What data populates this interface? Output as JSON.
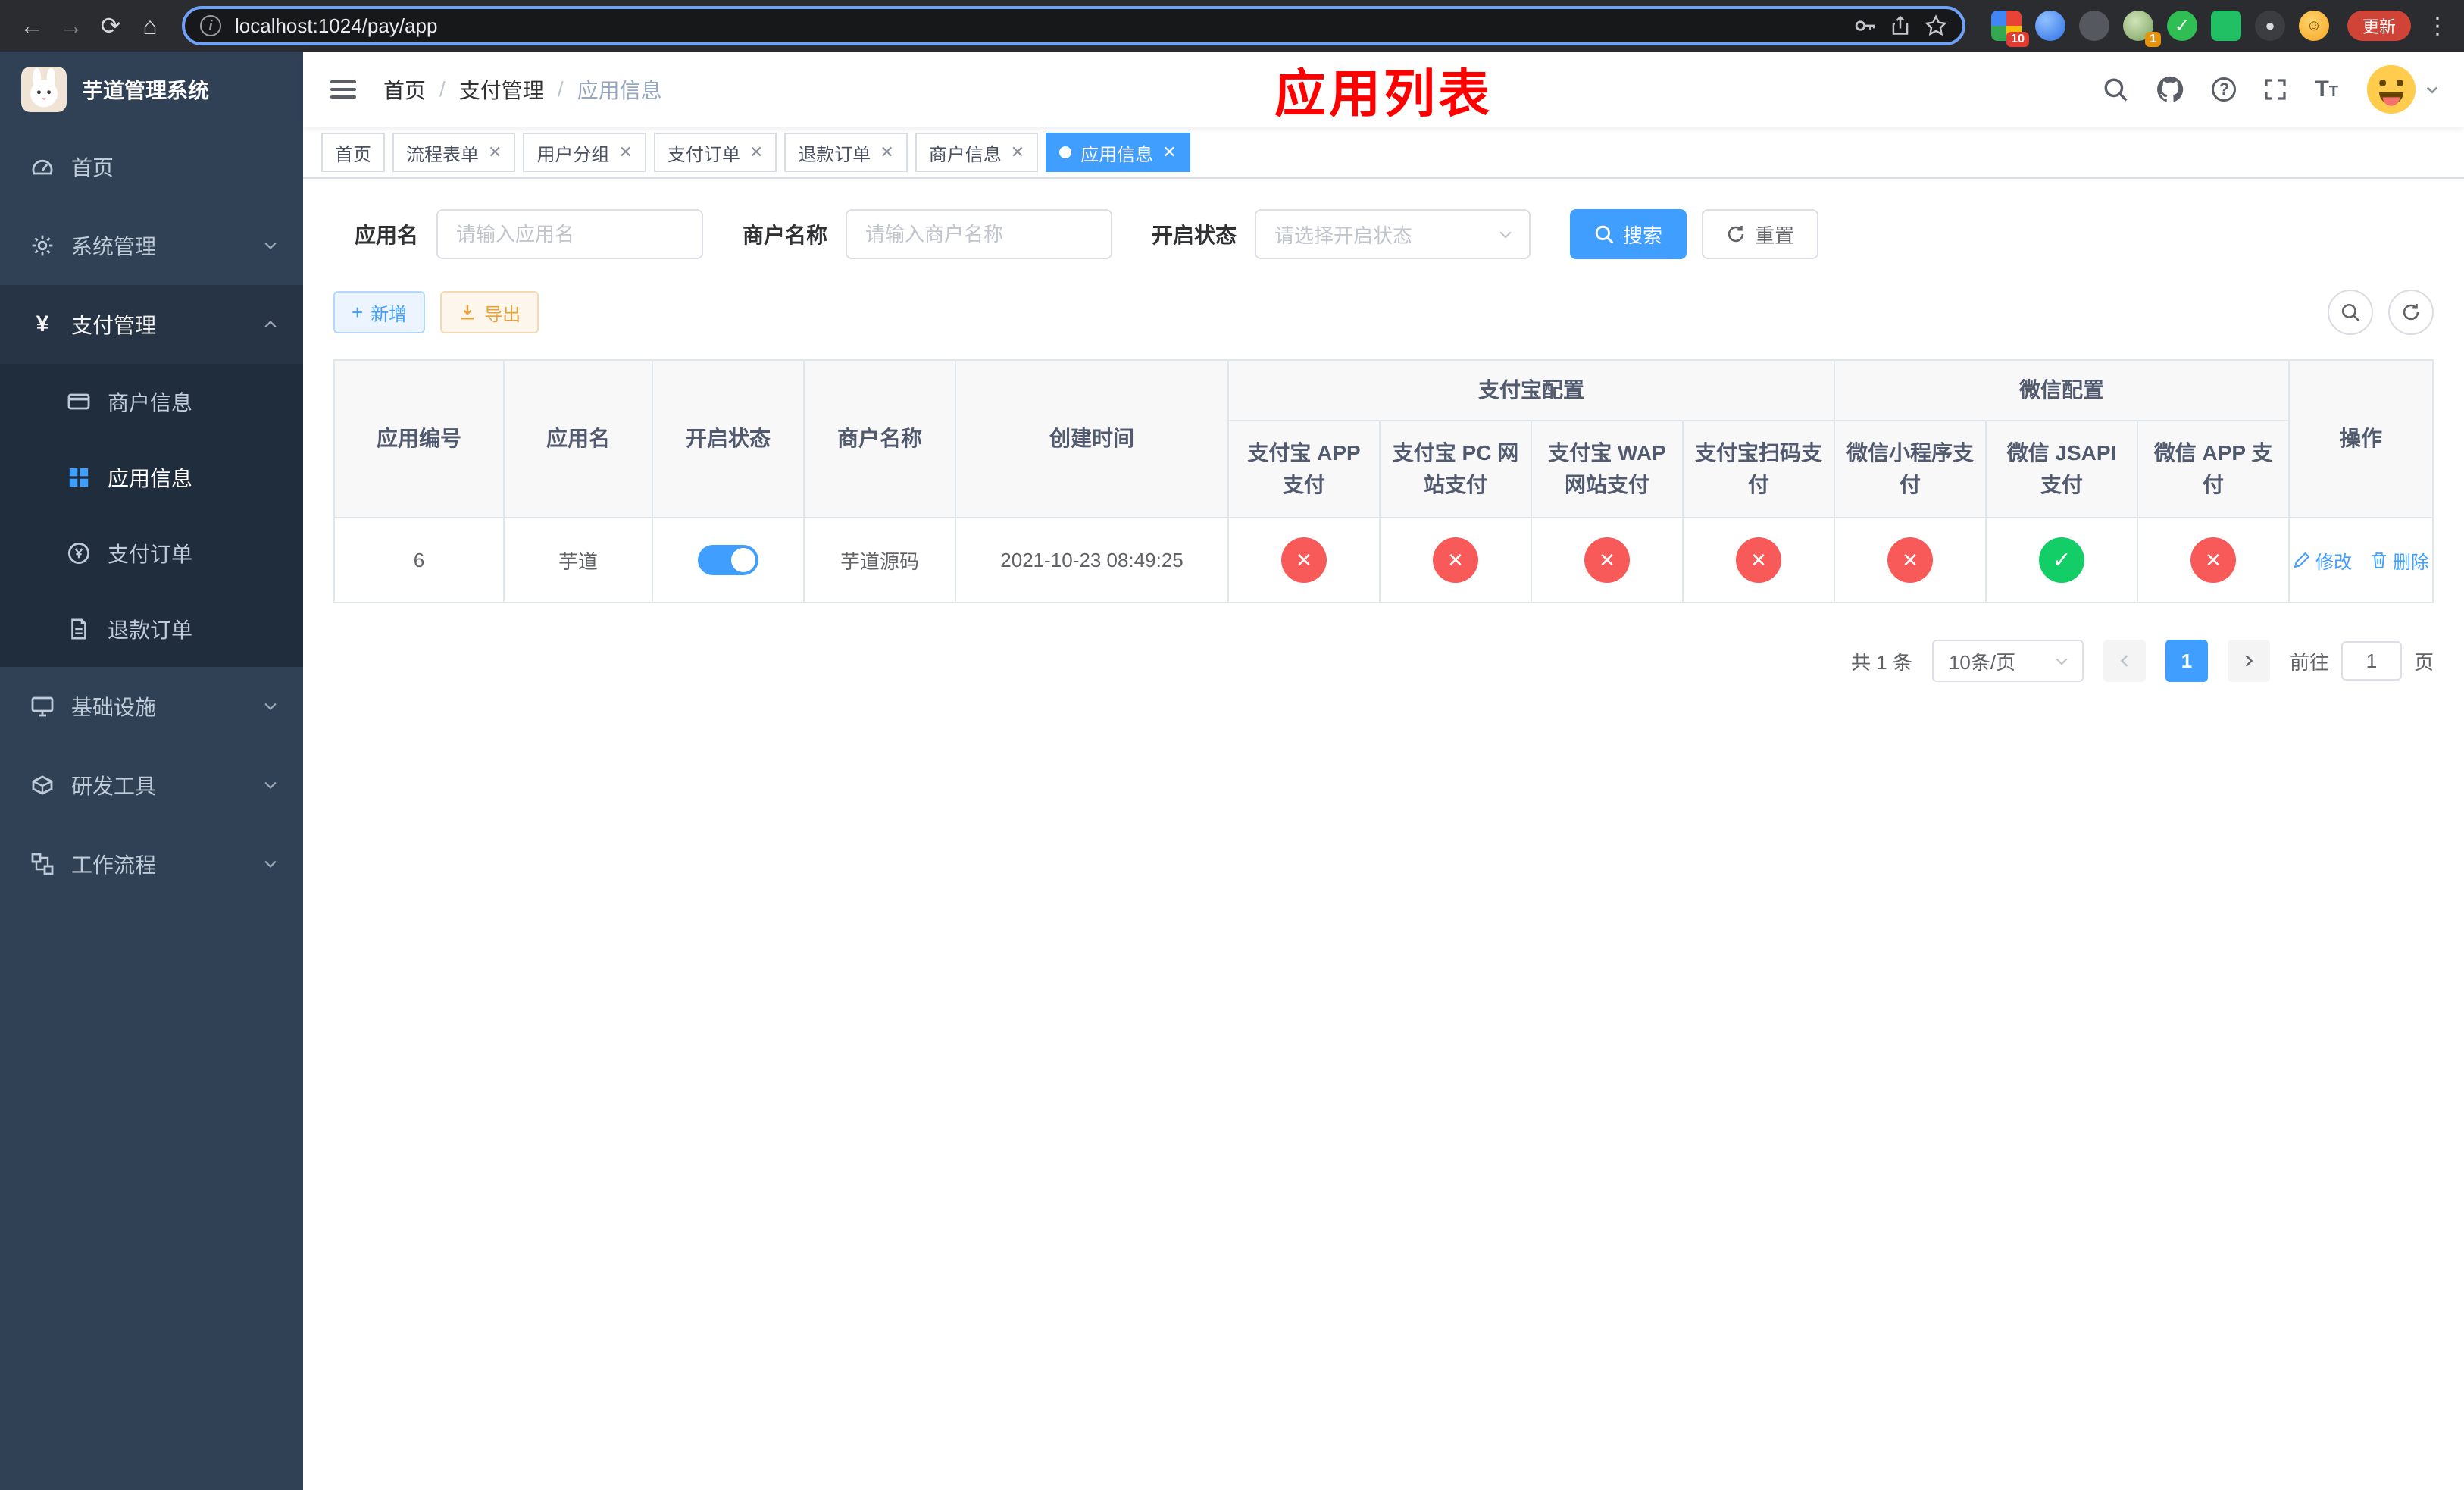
{
  "browser": {
    "url": "localhost:1024/pay/app",
    "update_label": "更新",
    "badges": {
      "extensions": "10",
      "profile": "1"
    }
  },
  "sidebar": {
    "title": "芋道管理系统",
    "items": {
      "home": "首页",
      "system": "系统管理",
      "payment": "支付管理",
      "infra": "基础设施",
      "devtools": "研发工具",
      "workflow": "工作流程"
    },
    "payment_children": {
      "merchant": "商户信息",
      "app": "应用信息",
      "order": "支付订单",
      "refund": "退款订单"
    }
  },
  "navbar": {
    "breadcrumb": {
      "home": "首页",
      "payment": "支付管理",
      "current": "应用信息"
    },
    "overlay_title": "应用列表"
  },
  "tags": {
    "t0": "首页",
    "t1": "流程表单",
    "t2": "用户分组",
    "t3": "支付订单",
    "t4": "退款订单",
    "t5": "商户信息",
    "t6": "应用信息"
  },
  "filter": {
    "app_name_label": "应用名",
    "app_name_placeholder": "请输入应用名",
    "merchant_label": "商户名称",
    "merchant_placeholder": "请输入商户名称",
    "status_label": "开启状态",
    "status_placeholder": "请选择开启状态",
    "search": "搜索",
    "reset": "重置"
  },
  "toolbar": {
    "add": "新增",
    "export": "导出"
  },
  "table": {
    "col_id": "应用编号",
    "col_name": "应用名",
    "col_status": "开启状态",
    "col_merchant": "商户名称",
    "col_created": "创建时间",
    "group_alipay": "支付宝配置",
    "group_wechat": "微信配置",
    "col_alipay_app": "支付宝 APP 支付",
    "col_alipay_pc": "支付宝 PC 网站支付",
    "col_alipay_wap": "支付宝 WAP 网站支付",
    "col_alipay_qr": "支付宝扫码支付",
    "col_wx_mini": "微信小程序支付",
    "col_wx_jsapi": "微信 JSAPI 支付",
    "col_wx_app": "微信 APP 支付",
    "col_actions": "操作",
    "row": {
      "id": "6",
      "name": "芋道",
      "merchant": "芋道源码",
      "created": "2021-10-23 08:49:25",
      "edit": "修改",
      "delete": "删除"
    }
  },
  "pagination": {
    "total": "共 1 条",
    "page_size": "10条/页",
    "page": "1",
    "goto_label": "前往",
    "goto_value": "1",
    "goto_suffix": "页"
  }
}
